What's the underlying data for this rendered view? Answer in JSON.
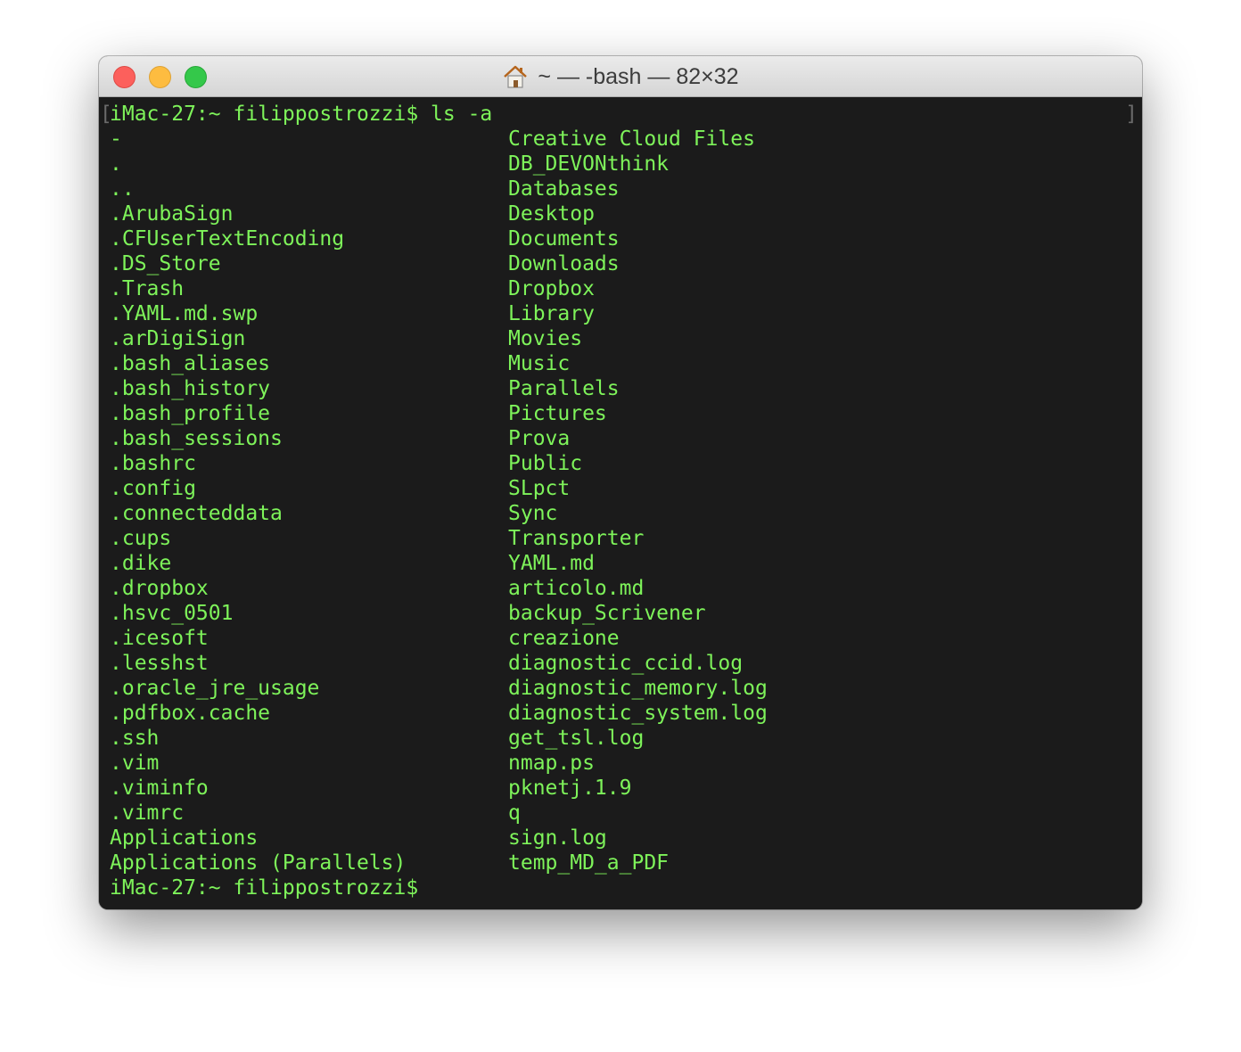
{
  "window": {
    "title": "~ — -bash — 82×32",
    "title_icon": "home-icon",
    "colors": {
      "terminal_bg": "#1b1b1b",
      "text": "#7ef35a",
      "close": "#fc605c",
      "minimize": "#fdbc40",
      "zoom": "#34c84a"
    }
  },
  "terminal": {
    "command_prompt": "iMac-27:~ filippostrozzi$ ls -a",
    "bracket_left": "[",
    "bracket_right": "]",
    "left_column": [
      "-",
      ".",
      "..",
      ".ArubaSign",
      ".CFUserTextEncoding",
      ".DS_Store",
      ".Trash",
      ".YAML.md.swp",
      ".arDigiSign",
      ".bash_aliases",
      ".bash_history",
      ".bash_profile",
      ".bash_sessions",
      ".bashrc",
      ".config",
      ".connecteddata",
      ".cups",
      ".dike",
      ".dropbox",
      ".hsvc_0501",
      ".icesoft",
      ".lesshst",
      ".oracle_jre_usage",
      ".pdfbox.cache",
      ".ssh",
      ".vim",
      ".viminfo",
      ".vimrc",
      "Applications",
      "Applications (Parallels)"
    ],
    "right_column": [
      "Creative Cloud Files",
      "DB_DEVONthink",
      "Databases",
      "Desktop",
      "Documents",
      "Downloads",
      "Dropbox",
      "Library",
      "Movies",
      "Music",
      "Parallels",
      "Pictures",
      "Prova",
      "Public",
      "SLpct",
      "Sync",
      "Transporter",
      "YAML.md",
      "articolo.md",
      "backup_Scrivener",
      "creazione",
      "diagnostic_ccid.log",
      "diagnostic_memory.log",
      "diagnostic_system.log",
      "get_tsl.log",
      "nmap.ps",
      "pknetj.1.9",
      "q",
      "sign.log",
      "temp_MD_a_PDF"
    ],
    "final_prompt": "iMac-27:~ filippostrozzi$"
  }
}
